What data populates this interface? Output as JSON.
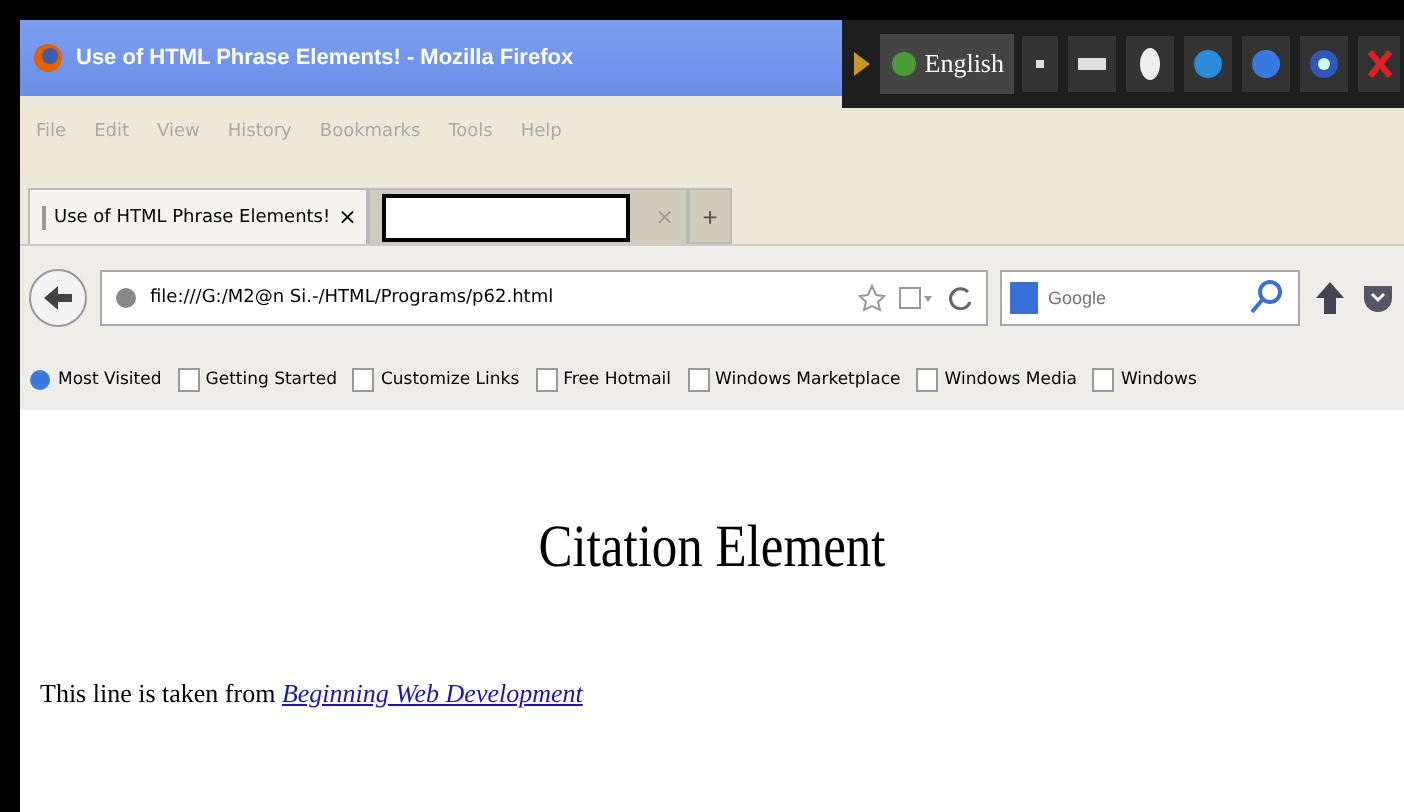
{
  "window": {
    "title": "Use of HTML Phrase Elements! - Mozilla Firefox"
  },
  "language_bar": {
    "language": "English"
  },
  "menu": [
    "File",
    "Edit",
    "View",
    "History",
    "Bookmarks",
    "Tools",
    "Help"
  ],
  "tabs": [
    {
      "label": "Use of HTML Phrase Elements!",
      "selected": true,
      "close": "×"
    },
    {
      "selected": false,
      "close": "×"
    }
  ],
  "new_tab": "+",
  "address_bar": {
    "url": "file:///G:/M2@n Si.-/HTML/Programs/p62.html"
  },
  "search": {
    "placeholder": "Google"
  },
  "bookmarks": [
    "Most Visited",
    "Getting Started",
    "Customize Links",
    "Free Hotmail",
    "Windows Marketplace",
    "Windows Media",
    "Windows"
  ],
  "page": {
    "heading": "Citation Element",
    "text": "This line is taken from ",
    "citation": "Beginning Web Development"
  }
}
